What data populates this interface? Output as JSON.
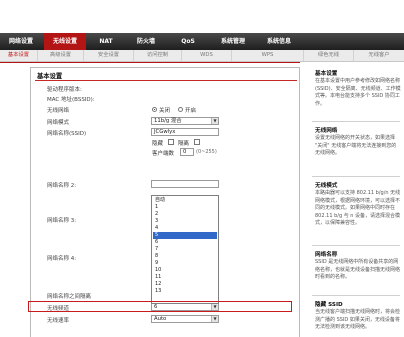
{
  "top_nav": {
    "tabs": [
      {
        "label": "网络设置"
      },
      {
        "label": "无线设置"
      },
      {
        "label": "NAT"
      },
      {
        "label": "防火墙"
      },
      {
        "label": "QoS"
      },
      {
        "label": "系统管理"
      },
      {
        "label": "系统信息"
      }
    ],
    "active_index": 1
  },
  "sub_nav": {
    "tabs": [
      {
        "label": "基本设置"
      },
      {
        "label": "高级设置"
      },
      {
        "label": "安全设置"
      },
      {
        "label": "访问控制"
      },
      {
        "label": "WDS"
      },
      {
        "label": "WPS"
      },
      {
        "label": "绿色无线"
      },
      {
        "label": "无线客户"
      }
    ],
    "active_index": 0
  },
  "form": {
    "section_title": "基本设置",
    "firmware_label": "驱动程序版本:",
    "mac_label": "MAC 地址(BSSID):",
    "wireless_label": "无线网络",
    "radio_off": "关闭",
    "radio_on": "开启",
    "mode_label": "网络模式",
    "mode_value": "11b/g 混合",
    "ssid_label": "网络名称(SSID)",
    "ssid_value": "JCGwlyx",
    "hidden_label": "隐藏",
    "isolate_label": "隔离",
    "client_count_label": "客户端数",
    "client_count_value": "0",
    "client_count_range": "(0~255)",
    "ssid2_label": "网络名称 2:",
    "ssid3_label": "网络名称 3:",
    "ssid4_label": "网络名称 4:",
    "inter_isolation_label": "网络名称之间隔离",
    "channel_label": "无线频道",
    "channel_value": "6",
    "speed_label": "无线速率",
    "speed_value": "Auto"
  },
  "channel_dropdown": {
    "options": [
      "自动",
      "1",
      "2",
      "3",
      "4",
      "5",
      "6",
      "7",
      "8",
      "9",
      "10",
      "11",
      "12",
      "13"
    ],
    "highlighted": "5"
  },
  "sidebar": {
    "sections": [
      {
        "title": "基本设置",
        "text": "在基本设置中用户参考修改如网络名称 (SSID)、安全隔离、无线频道、工作模式等。本电台能支持多个 SSID 协同工作。"
      },
      {
        "title": "无线网络",
        "text": "设置无线网络的开关状态，如果选择 \"关闭\" 无线客户端将无法连接到您的无线网络。"
      },
      {
        "title": "无线模式",
        "text": "本路由器可以支持 802.11 b/g/n 无线网络模式，根据网络环境，可以选择不同的无线模式。如果网络中同时存在 802.11 b/g 与 n 设备，请选择混合模式，以保障兼容性。"
      },
      {
        "title": "网络名称",
        "text": "SSID 是无线网络中所有设备共享的网络名称，也就是无线设备扫描无线网络时看到的名称。"
      },
      {
        "title": "隐藏 SSID",
        "text": "当无线客户端扫描无线网络时，将会检测广播的 SSID 如果关闭，无线设备将无法检测到该无线网络。"
      }
    ]
  }
}
